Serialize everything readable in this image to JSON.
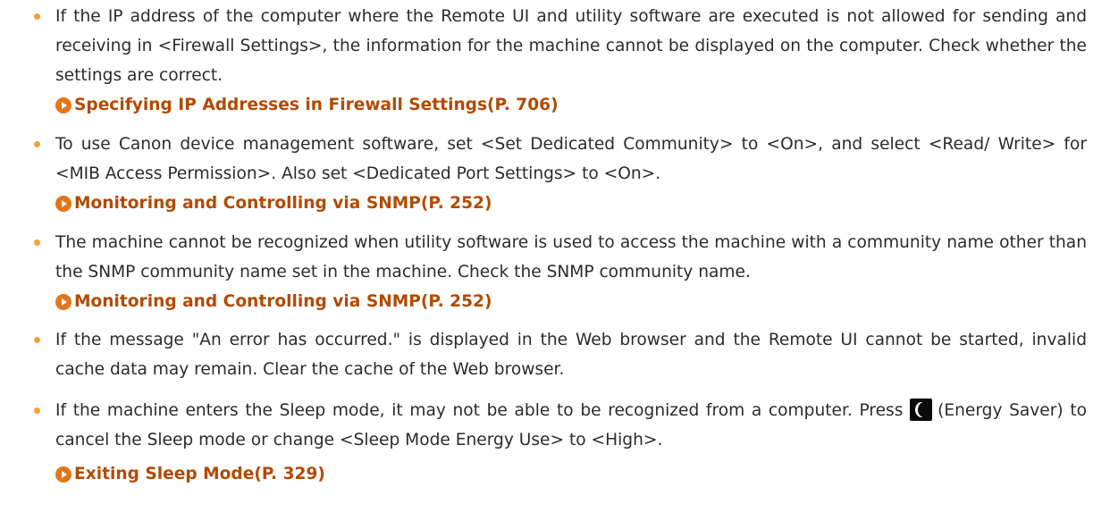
{
  "items": [
    {
      "text": "If the IP address of the computer where the Remote UI and utility software are executed is not allowed for sending and receiving in <Firewall Settings>, the information for the machine cannot be displayed on the computer. Check whether the settings are correct.",
      "link": "Specifying IP Addresses in Firewall Settings(P. 706)"
    },
    {
      "text": "To use Canon device management software, set <Set Dedicated Community> to <On>, and select <Read/ Write> for <MIB Access Permission>. Also set <Dedicated Port Settings> to <On>.",
      "link": "Monitoring and Controlling via SNMP(P. 252)"
    },
    {
      "text": "The machine cannot be recognized when utility software is used to access the machine with a community name other than the SNMP community name set in the machine. Check the SNMP community name.",
      "link": "Monitoring and Controlling via SNMP(P. 252)"
    },
    {
      "text": "If the message \"An error has occurred.\" is displayed in the Web browser and the Remote UI cannot be started, invalid cache data may remain. Clear the cache of the Web browser."
    },
    {
      "text_before_icon": "If the machine enters the Sleep mode, it may not be able to be recognized from a computer. Press",
      "icon": "energy-saver-moon-icon",
      "text_after_icon": "(Energy Saver) to cancel the Sleep mode or change <Sleep Mode Energy Use> to <High>.",
      "link": "Exiting Sleep Mode(P. 329)"
    }
  ],
  "colors": {
    "bullet": "#f0a13a",
    "link": "#b34a00",
    "link_arrow": "#e2761a",
    "text": "#2b2b2b"
  }
}
